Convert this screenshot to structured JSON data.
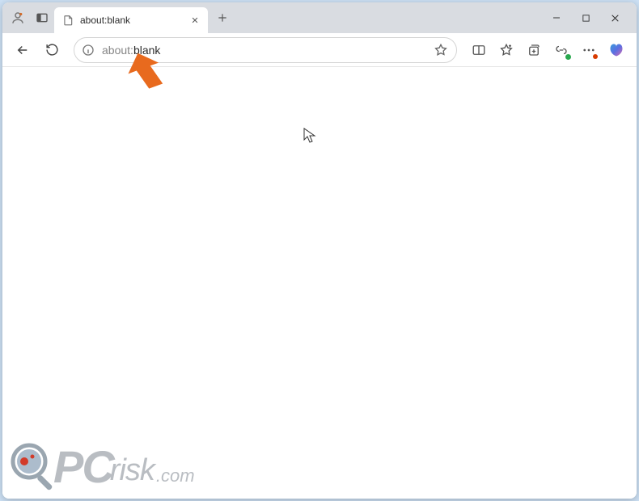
{
  "tab": {
    "title": "about:blank"
  },
  "address": {
    "scheme": "about:",
    "path": "blank"
  },
  "watermark": {
    "pc": "PC",
    "risk": "risk",
    "com": ".com"
  },
  "annotation": {
    "arrow_color": "#e86a1e"
  }
}
